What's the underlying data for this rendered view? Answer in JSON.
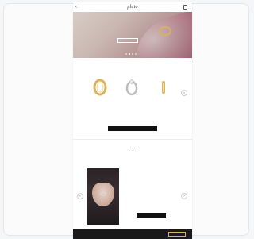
{
  "header": {
    "logo_text": "pluto",
    "back_icon": "chevron-left-icon",
    "bag_icon": "shopping-bag-icon"
  },
  "hero": {
    "title": "",
    "subtitle": "",
    "cta_label": "",
    "slide_count": 4,
    "active_slide": 1
  },
  "bestsellers": {
    "title": "",
    "products": [
      {
        "name": "",
        "price": "",
        "color": "#d9b45a"
      },
      {
        "name": "",
        "price": "",
        "color": "#c9c9c9"
      },
      {
        "name": "",
        "price": "",
        "color": "#d9b45a"
      }
    ],
    "cta_label": ""
  },
  "looks": {
    "title": "",
    "caption": "",
    "cta_label": ""
  },
  "footer": {
    "text": "",
    "button_label": ""
  },
  "colors": {
    "accent_gold": "#d4b45c",
    "dark": "#111111"
  }
}
